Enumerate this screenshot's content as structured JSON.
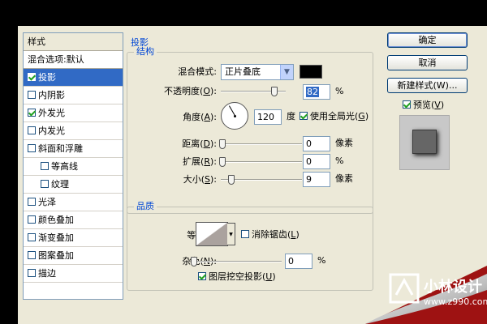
{
  "styles_panel": {
    "header": "样式",
    "blend_options": "混合选项:默认",
    "items": [
      {
        "label": "投影",
        "checked": true,
        "selected": true,
        "indent": false
      },
      {
        "label": "内阴影",
        "checked": false,
        "selected": false,
        "indent": false
      },
      {
        "label": "外发光",
        "checked": true,
        "selected": false,
        "indent": false
      },
      {
        "label": "内发光",
        "checked": false,
        "selected": false,
        "indent": false
      },
      {
        "label": "斜面和浮雕",
        "checked": false,
        "selected": false,
        "indent": false
      },
      {
        "label": "等高线",
        "checked": false,
        "selected": false,
        "indent": true
      },
      {
        "label": "纹理",
        "checked": false,
        "selected": false,
        "indent": true
      },
      {
        "label": "光泽",
        "checked": false,
        "selected": false,
        "indent": false
      },
      {
        "label": "颜色叠加",
        "checked": false,
        "selected": false,
        "indent": false
      },
      {
        "label": "渐变叠加",
        "checked": false,
        "selected": false,
        "indent": false
      },
      {
        "label": "图案叠加",
        "checked": false,
        "selected": false,
        "indent": false
      },
      {
        "label": "描边",
        "checked": false,
        "selected": false,
        "indent": false
      }
    ]
  },
  "drop_shadow": {
    "title": "投影",
    "structure": {
      "title": "结构",
      "blend_mode_label": "混合模式:",
      "blend_mode_value": "正片叠底",
      "shadow_color": "#000000",
      "opacity_label": "不透明度",
      "opacity_key": "O",
      "opacity_value": "82",
      "opacity_unit": "%",
      "angle_label": "角度",
      "angle_key": "A",
      "angle_value": "120",
      "angle_unit": "度",
      "global_light_label": "使用全局光",
      "global_light_key": "G",
      "global_light_checked": true,
      "distance_label": "距离",
      "distance_key": "D",
      "distance_value": "0",
      "distance_unit": "像素",
      "spread_label": "扩展",
      "spread_key": "R",
      "spread_value": "0",
      "spread_unit": "%",
      "size_label": "大小",
      "size_key": "S",
      "size_value": "9",
      "size_unit": "像素"
    },
    "quality": {
      "title": "品质",
      "contour_label": "等高线:",
      "anti_alias_label": "消除锯齿",
      "anti_alias_key": "L",
      "anti_alias_checked": false,
      "noise_label": "杂色",
      "noise_key": "N",
      "noise_value": "0",
      "noise_unit": "%"
    },
    "layer_knockout_label": "图层挖空投影",
    "layer_knockout_key": "U",
    "layer_knockout_checked": true
  },
  "buttons": {
    "ok": "确定",
    "cancel": "取消",
    "new_style": "新建样式(W)...",
    "preview_label": "预览",
    "preview_key": "V",
    "preview_checked": true
  },
  "watermark": {
    "name": "小林设计",
    "url": "www.z990.com"
  }
}
